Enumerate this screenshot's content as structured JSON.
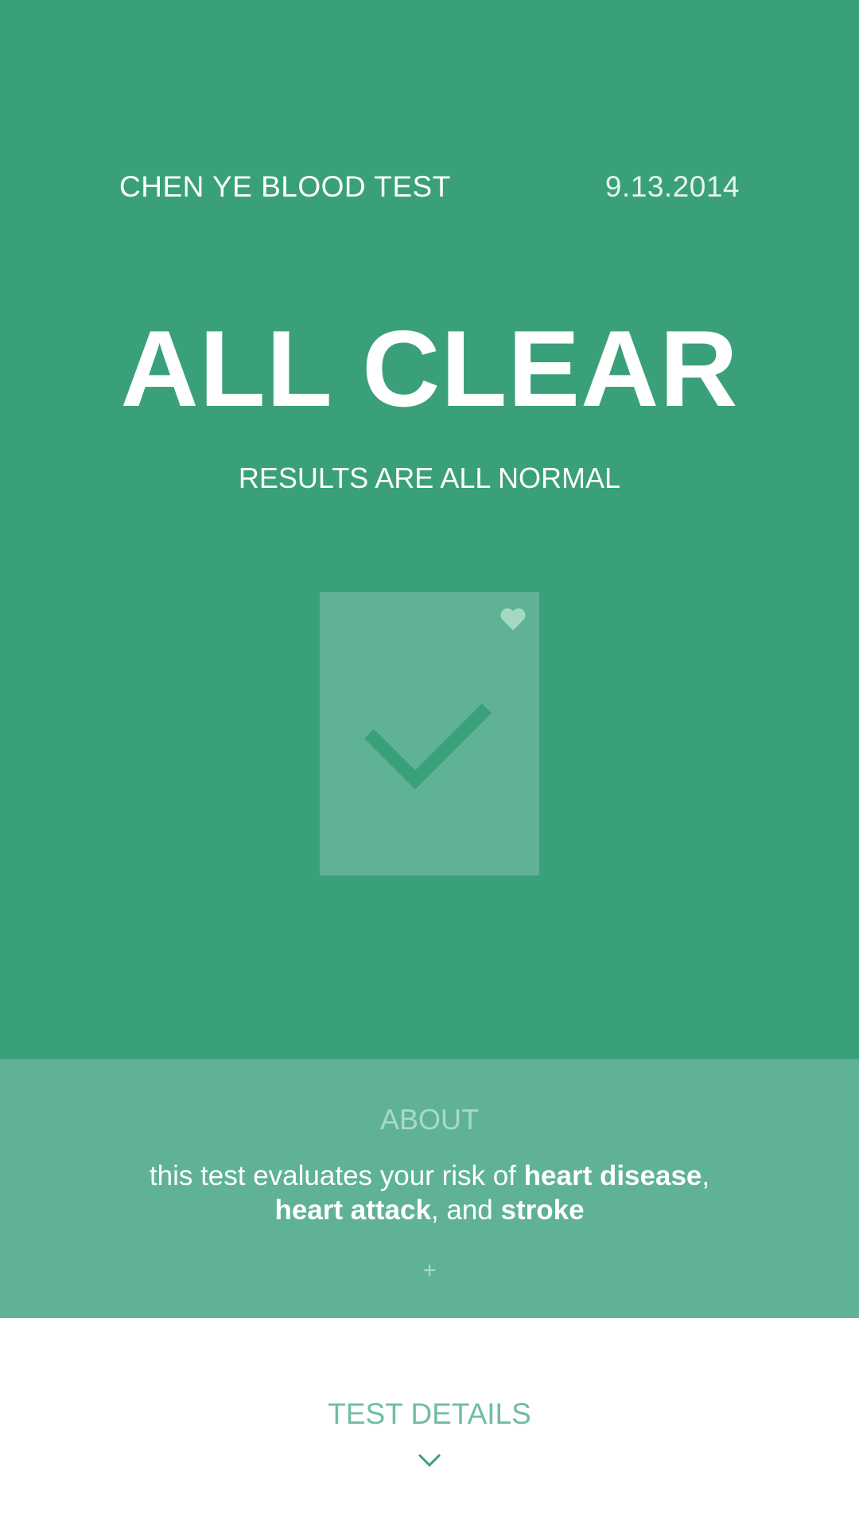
{
  "header": {
    "title": "CHEN YE BLOOD TEST",
    "date": "9.13.2014"
  },
  "status": {
    "headline": "ALL CLEAR",
    "subtitle": "RESULTS ARE ALL NORMAL"
  },
  "card": {
    "icons": [
      "heart-icon",
      "check-icon"
    ]
  },
  "about": {
    "heading": "ABOUT",
    "text_prefix": "this test evaluates your risk of ",
    "highlight_1": "heart disease",
    "sep_1": ",",
    "highlight_2": "heart attack",
    "sep_2": ", and ",
    "highlight_3": "stroke",
    "expand_label": "+"
  },
  "details": {
    "heading": "TEST DETAILS",
    "icon": "chevron-down-icon"
  },
  "colors": {
    "primary": "#3aa07a",
    "secondary": "#5fb295",
    "accent_text": "#6fbe9f",
    "muted_text": "#a9dac6"
  }
}
